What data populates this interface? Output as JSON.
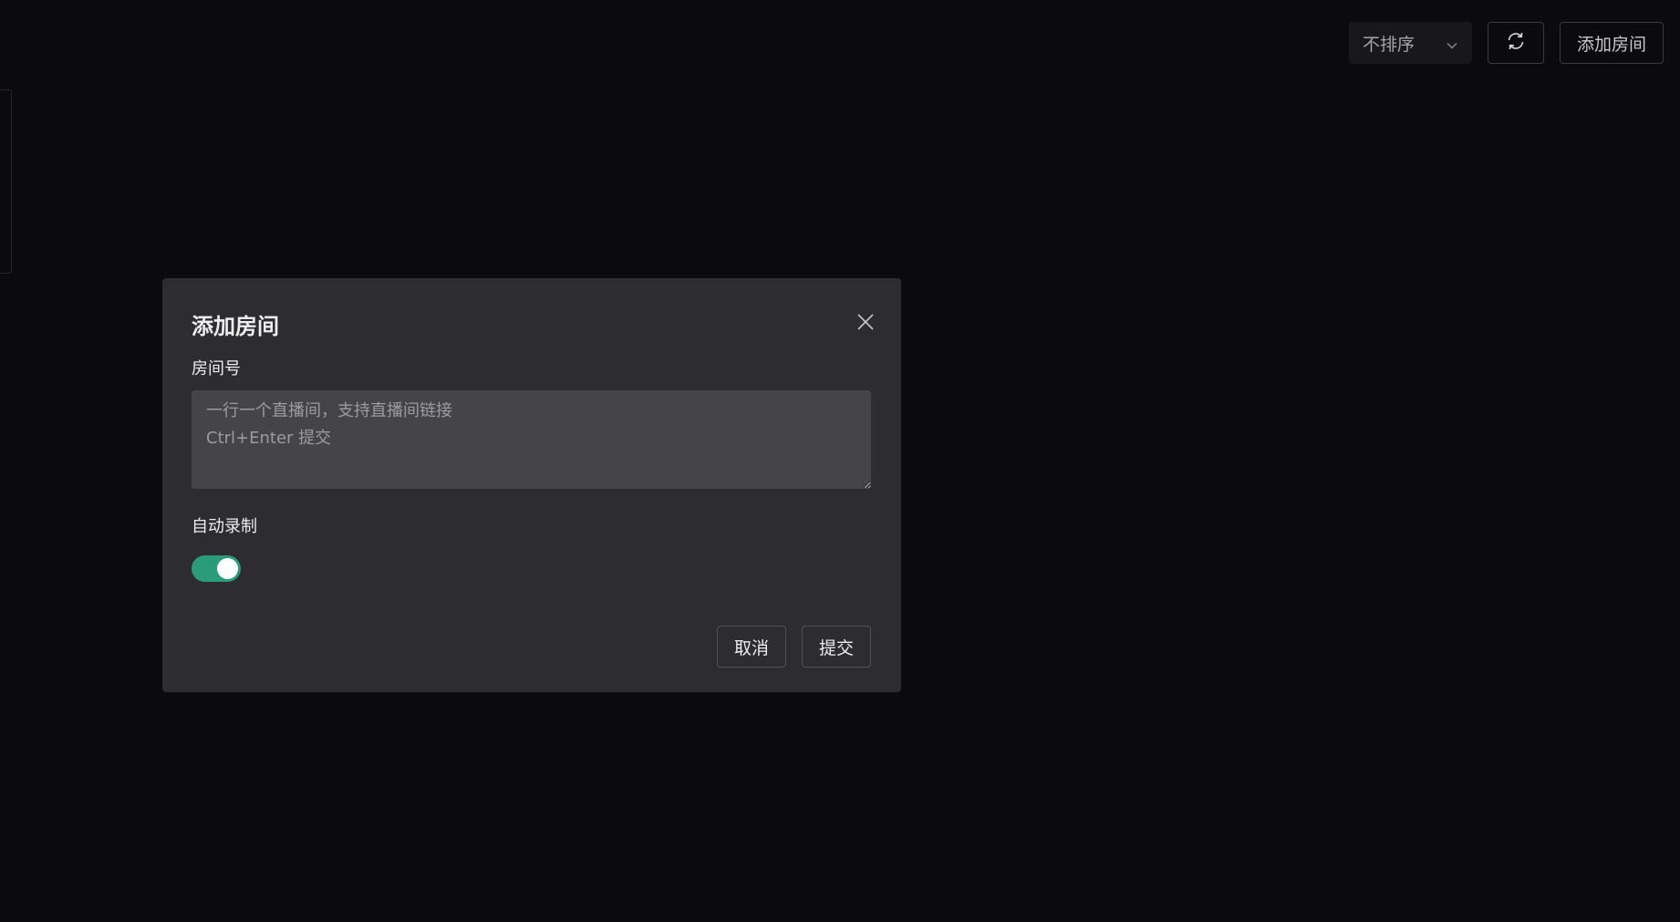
{
  "toolbar": {
    "sort_select": {
      "value": "不排序",
      "icon": "chevron-down-icon"
    },
    "refresh_icon": "refresh-icon",
    "add_room_label": "添加房间"
  },
  "modal": {
    "title": "添加房间",
    "close_icon": "close-icon",
    "room_field": {
      "label": "房间号",
      "value": "",
      "placeholder": "一行一个直播间，支持直播间链接\nCtrl+Enter 提交"
    },
    "auto_record": {
      "label": "自动录制",
      "on": true
    },
    "cancel_label": "取消",
    "submit_label": "提交"
  },
  "colors": {
    "background": "#0b0b0d",
    "modal_bg": "#2c2c31",
    "input_bg": "#444449",
    "toggle_on": "#2a9d78"
  }
}
